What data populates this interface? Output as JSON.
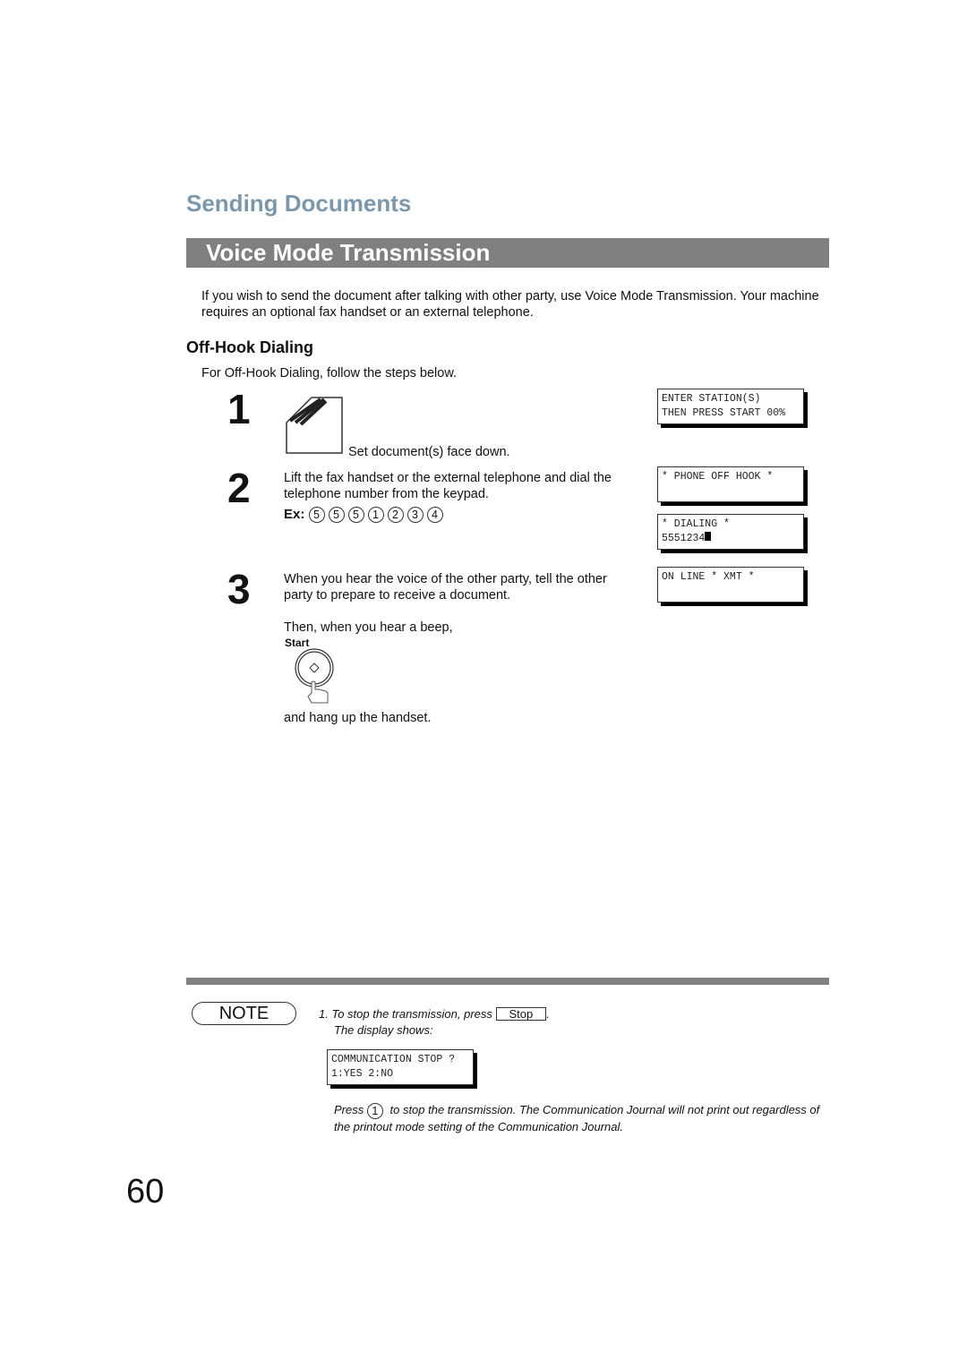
{
  "section_title": "Sending Documents",
  "heading": "Voice Mode Transmission",
  "intro": "If you wish to send the document after talking with other party, use Voice Mode Transmission.  Your machine requires an optional fax handset or an external telephone.",
  "subheading": "Off-Hook Dialing",
  "subintro": "For Off-Hook Dialing, follow the steps below.",
  "steps": [
    {
      "number": "1",
      "text": "Set document(s) face down."
    },
    {
      "number": "2",
      "text": "Lift the fax handset or the external telephone and dial the telephone number from the keypad.",
      "example_label": "Ex:",
      "example_keys": [
        "5",
        "5",
        "5",
        "1",
        "2",
        "3",
        "4"
      ]
    },
    {
      "number": "3",
      "text": "When you hear the voice of the other party, tell the other party to prepare to receive a document.",
      "text2": "Then, when you hear a beep,",
      "button_label": "Start",
      "text3": "and hang up the handset."
    }
  ],
  "displays": {
    "d1": "ENTER STATION(S)\nTHEN PRESS START 00%",
    "d2": "* PHONE OFF HOOK *",
    "d3": "* DIALING *\n5551234",
    "d4": "ON LINE * XMT *"
  },
  "note": {
    "label": "NOTE",
    "item_prefix": "1. To stop the transmission, press",
    "stop_key": "Stop",
    "period": ".",
    "display_shows": "The display shows:",
    "display": "COMMUNICATION STOP ?\n1:YES 2:NO",
    "press": "Press",
    "press_key": "1",
    "press_rest": "to stop the transmission. The Communication Journal will not print out regardless of the printout mode setting of the Communication Journal."
  },
  "page_number": "60",
  "colors": {
    "section_title": "#7b97ae",
    "heading_bar": "#808080"
  }
}
